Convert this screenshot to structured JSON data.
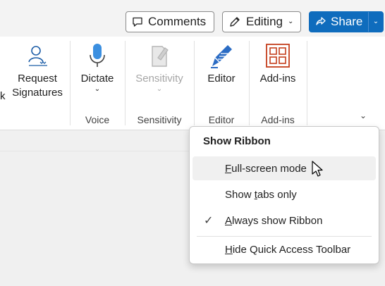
{
  "topbar": {
    "comments_label": "Comments",
    "editing_label": "Editing",
    "share_label": "Share",
    "accent": "#0f6cbd"
  },
  "ribbon": {
    "cutoff_char": "k",
    "groups": [
      {
        "commands": [
          {
            "label_line1": "Request",
            "label_line2": "Signatures",
            "icon": "signature-icon"
          }
        ],
        "group_label": ""
      },
      {
        "commands": [
          {
            "label": "Dictate",
            "icon": "microphone-icon"
          }
        ],
        "group_label": "Voice"
      },
      {
        "commands": [
          {
            "label": "Sensitivity",
            "icon": "sensitivity-icon",
            "disabled": true
          }
        ],
        "group_label": "Sensitivity"
      },
      {
        "commands": [
          {
            "label": "Editor",
            "icon": "editor-pen-icon"
          }
        ],
        "group_label": "Editor"
      },
      {
        "commands": [
          {
            "label": "Add-ins",
            "icon": "add-ins-grid-icon"
          }
        ],
        "group_label": "Add-ins"
      }
    ]
  },
  "menu": {
    "title": "Show Ribbon",
    "items": [
      {
        "mnemonic": "F",
        "rest": "ull-screen mode",
        "hover": true
      },
      {
        "pre": "Show ",
        "mnemonic": "t",
        "rest": "abs only"
      },
      {
        "mnemonic": "A",
        "rest": "lways show Ribbon",
        "checked": true
      },
      {
        "mnemonic": "H",
        "rest": "ide Quick Access Toolbar"
      }
    ]
  }
}
